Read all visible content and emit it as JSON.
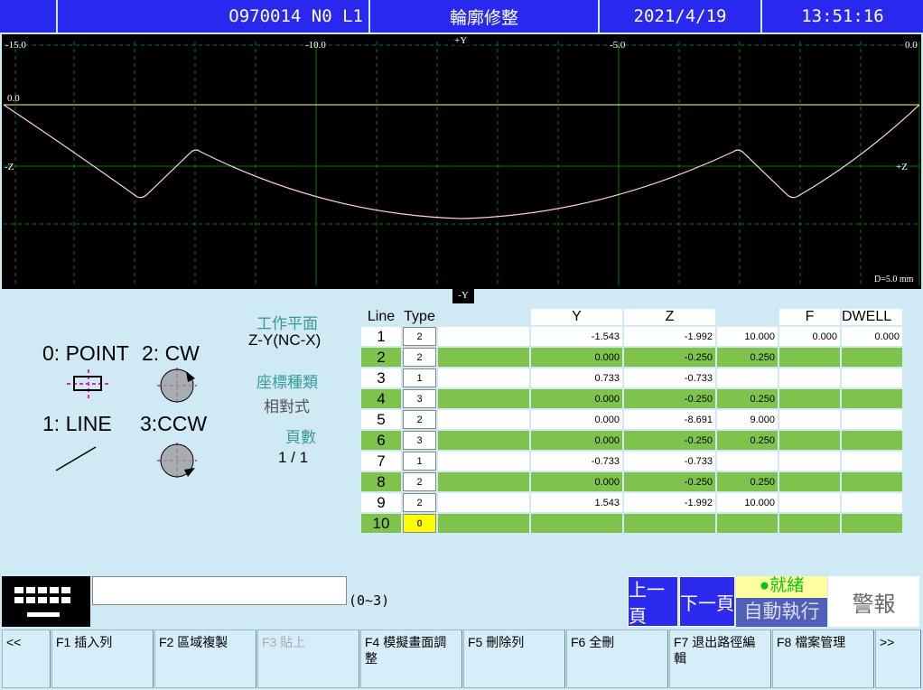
{
  "header": {
    "program": "O970014 N0 L1",
    "title": "輪廓修整",
    "date": "2021/4/19",
    "time": "13:51:16"
  },
  "plot": {
    "labels": {
      "x_m15": "-15.0",
      "x_m10": "-10.0",
      "x_m5": "-5.0",
      "x_0": "0.0",
      "plus_y": "+Y",
      "minus_y": "-Y",
      "zero": "0.0",
      "minus_z": "-Z",
      "plus_z": "+Z",
      "scale": "D=5.0 mm"
    },
    "colors": {
      "grid": "#0d7a0d",
      "axis": "#ffff80",
      "path": "#ffd0e0"
    }
  },
  "legend": {
    "point": "0: POINT",
    "cw": "2: CW",
    "line": "1: LINE",
    "ccw": "3:CCW"
  },
  "info": {
    "plane_label": "工作平面",
    "plane_value": "Z-Y(NC-X)",
    "coord_label": "座標種類",
    "coord_value": "相對式",
    "page_label": "頁數",
    "page_value": "1 / 1"
  },
  "table": {
    "headers": {
      "line": "Line",
      "type": "Type",
      "y": "Y",
      "z": "Z",
      "f": "F",
      "dwell": "DWELL"
    },
    "rows": [
      {
        "line": "1",
        "type": "2",
        "y": "-1.543",
        "z": "-1.992",
        "r": "10.000",
        "f": "0.000",
        "dwell": "0.000"
      },
      {
        "line": "2",
        "type": "2",
        "y": "0.000",
        "z": "-0.250",
        "r": "0.250",
        "f": "",
        "dwell": ""
      },
      {
        "line": "3",
        "type": "1",
        "y": "0.733",
        "z": "-0.733",
        "r": "",
        "f": "",
        "dwell": ""
      },
      {
        "line": "4",
        "type": "3",
        "y": "0.000",
        "z": "-0.250",
        "r": "0.250",
        "f": "",
        "dwell": ""
      },
      {
        "line": "5",
        "type": "2",
        "y": "0.000",
        "z": "-8.691",
        "r": "9.000",
        "f": "",
        "dwell": ""
      },
      {
        "line": "6",
        "type": "3",
        "y": "0.000",
        "z": "-0.250",
        "r": "0.250",
        "f": "",
        "dwell": ""
      },
      {
        "line": "7",
        "type": "1",
        "y": "-0.733",
        "z": "-0.733",
        "r": "",
        "f": "",
        "dwell": ""
      },
      {
        "line": "8",
        "type": "2",
        "y": "0.000",
        "z": "-0.250",
        "r": "0.250",
        "f": "",
        "dwell": ""
      },
      {
        "line": "9",
        "type": "2",
        "y": "1.543",
        "z": "-1.992",
        "r": "10.000",
        "f": "",
        "dwell": ""
      },
      {
        "line": "10",
        "type": "0",
        "y": "",
        "z": "",
        "r": "",
        "f": "",
        "dwell": ""
      }
    ]
  },
  "input": {
    "value": "",
    "range_hint": "(0~3)"
  },
  "buttons": {
    "prev_page": "上一頁",
    "next_page": "下一頁",
    "ready": "●就緒",
    "auto_run": "自動執行",
    "alarm": "警報"
  },
  "fkeys": [
    {
      "label": "<<",
      "enabled": true
    },
    {
      "label": "F1 插入列",
      "enabled": true
    },
    {
      "label": "F2 區域複製",
      "enabled": true
    },
    {
      "label": "F3 貼上",
      "enabled": false
    },
    {
      "label": "F4 模擬畫面調整",
      "enabled": true
    },
    {
      "label": "F5 刪除列",
      "enabled": true
    },
    {
      "label": "F6 全刪",
      "enabled": true
    },
    {
      "label": "F7 退出路徑編輯",
      "enabled": true
    },
    {
      "label": "F8 檔案管理",
      "enabled": true
    },
    {
      "label": ">>",
      "enabled": true
    }
  ]
}
